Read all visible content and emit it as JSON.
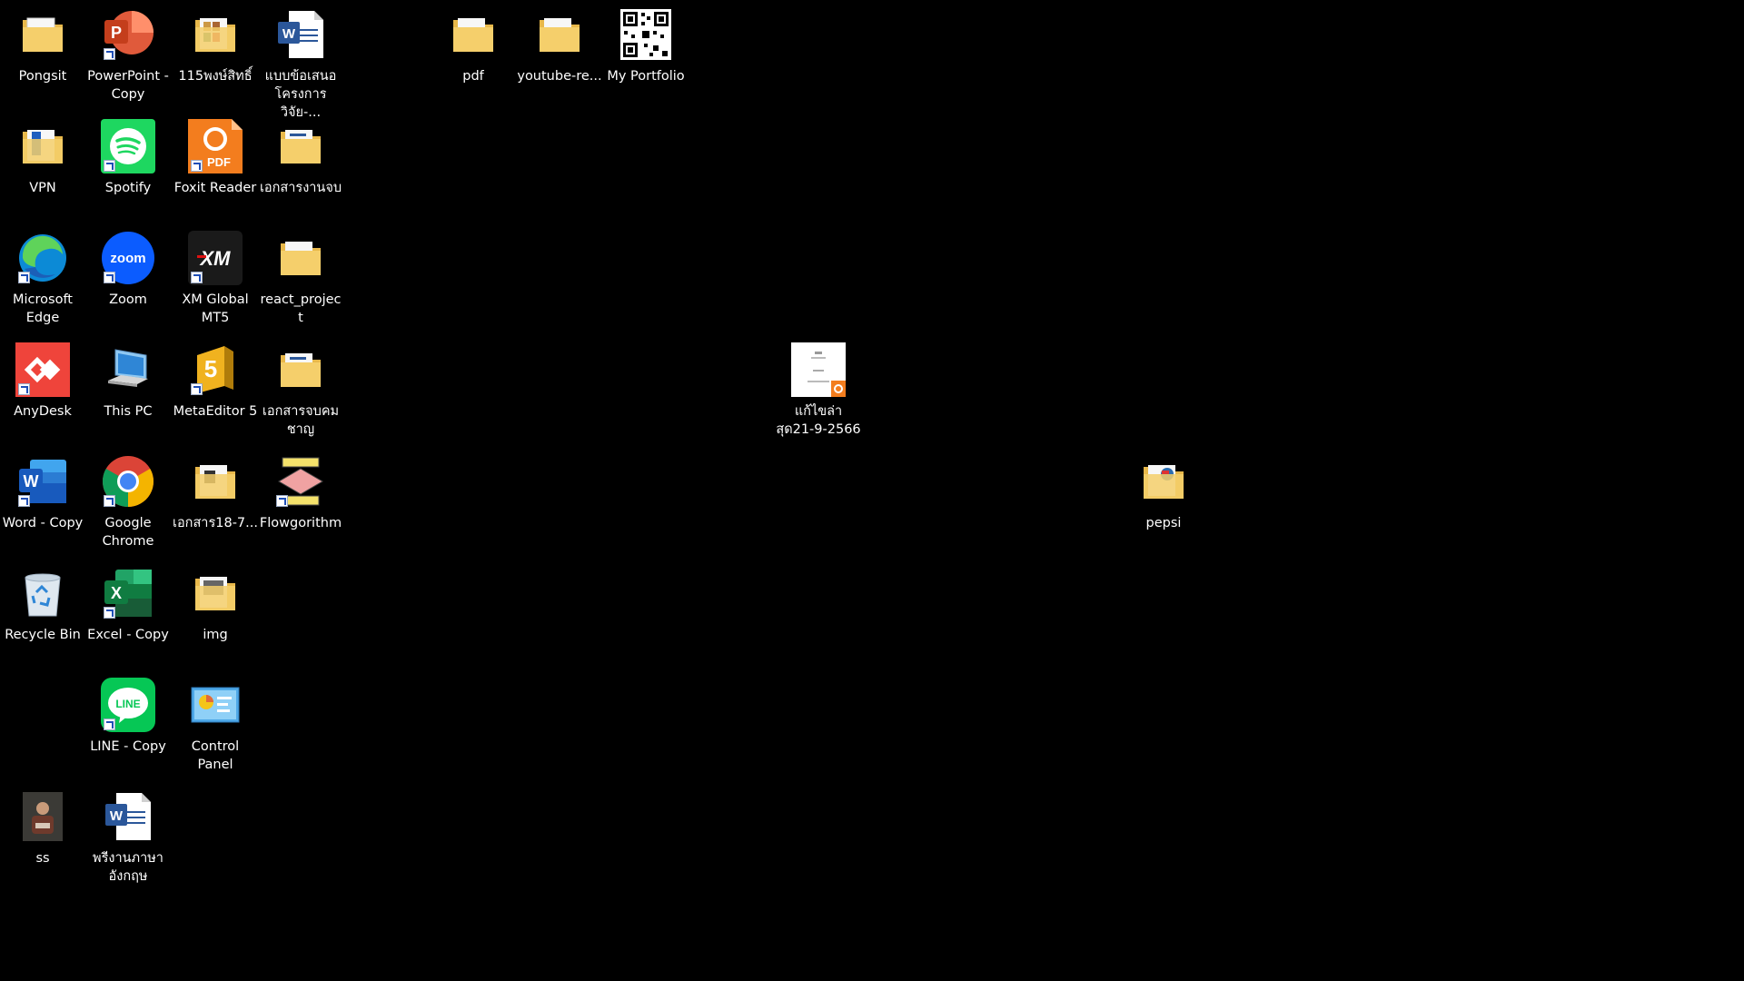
{
  "desktop": {
    "background_color": "#000000",
    "icons": [
      {
        "name": "folder-pongsit",
        "icon": "folder-icon",
        "label": "Pongsit"
      },
      {
        "name": "powerpoint-copy",
        "icon": "powerpoint-icon",
        "label": "PowerPoint - Copy",
        "shortcut": true
      },
      {
        "name": "folder-115",
        "icon": "folder-icon",
        "label": "115พงษ์สิทธิ์"
      },
      {
        "name": "word-doc-proposal",
        "icon": "word-document-icon",
        "label": "แบบข้อเสนอ โครงการวิจัย-..."
      },
      {
        "name": "folder-pdf",
        "icon": "folder-icon",
        "label": "pdf"
      },
      {
        "name": "folder-youtube",
        "icon": "folder-icon",
        "label": "youtube-re..."
      },
      {
        "name": "my-portfolio",
        "icon": "qr-code-icon",
        "label": "My Portfolio"
      },
      {
        "name": "folder-vpn",
        "icon": "folder-icon",
        "label": "VPN"
      },
      {
        "name": "spotify",
        "icon": "spotify-icon",
        "label": "Spotify",
        "shortcut": true
      },
      {
        "name": "foxit-reader",
        "icon": "foxit-pdf-icon",
        "label": "Foxit Reader",
        "shortcut": true
      },
      {
        "name": "folder-documents-end",
        "icon": "folder-icon",
        "label": "เอกสารงานจบ"
      },
      {
        "name": "microsoft-edge",
        "icon": "edge-icon",
        "label": "Microsoft Edge",
        "shortcut": true
      },
      {
        "name": "zoom",
        "icon": "zoom-icon",
        "label": "Zoom",
        "shortcut": true
      },
      {
        "name": "xm-global-mt5",
        "icon": "xm-icon",
        "label": "XM Global MT5",
        "shortcut": true
      },
      {
        "name": "folder-react-project",
        "icon": "folder-icon",
        "label": "react_project"
      },
      {
        "name": "pdf-fix-latest",
        "icon": "pdf-document-icon",
        "label": "แก้ไขล่า สุด21-9-2566"
      },
      {
        "name": "anydesk",
        "icon": "anydesk-icon",
        "label": "AnyDesk",
        "shortcut": true
      },
      {
        "name": "this-pc",
        "icon": "this-pc-icon",
        "label": "This PC"
      },
      {
        "name": "metaeditor-5",
        "icon": "metaeditor-icon",
        "label": "MetaEditor 5",
        "shortcut": true
      },
      {
        "name": "folder-documents-chayan",
        "icon": "folder-icon",
        "label": "เอกสารจบคม ชาญ"
      },
      {
        "name": "folder-pepsi",
        "icon": "folder-icon",
        "label": "pepsi"
      },
      {
        "name": "word-copy",
        "icon": "word-icon",
        "label": "Word - Copy",
        "shortcut": true
      },
      {
        "name": "google-chrome",
        "icon": "chrome-icon",
        "label": "Google Chrome",
        "shortcut": true
      },
      {
        "name": "folder-documents-18",
        "icon": "folder-icon",
        "label": "เอกสาร18-7..."
      },
      {
        "name": "flowgorithm",
        "icon": "flowgorithm-icon",
        "label": "Flowgorithm",
        "shortcut": true
      },
      {
        "name": "recycle-bin",
        "icon": "recycle-bin-icon",
        "label": "Recycle Bin"
      },
      {
        "name": "excel-copy",
        "icon": "excel-icon",
        "label": "Excel - Copy",
        "shortcut": true
      },
      {
        "name": "folder-img",
        "icon": "folder-icon",
        "label": "img"
      },
      {
        "name": "line-copy",
        "icon": "line-icon",
        "label": "LINE - Copy",
        "shortcut": true
      },
      {
        "name": "control-panel",
        "icon": "control-panel-icon",
        "label": "Control Panel"
      },
      {
        "name": "image-ss",
        "icon": "photo-thumbnail-icon",
        "label": "ss"
      },
      {
        "name": "word-doc-english",
        "icon": "word-document-icon",
        "label": "พรีงานภาษา อังกฤษ"
      }
    ]
  }
}
